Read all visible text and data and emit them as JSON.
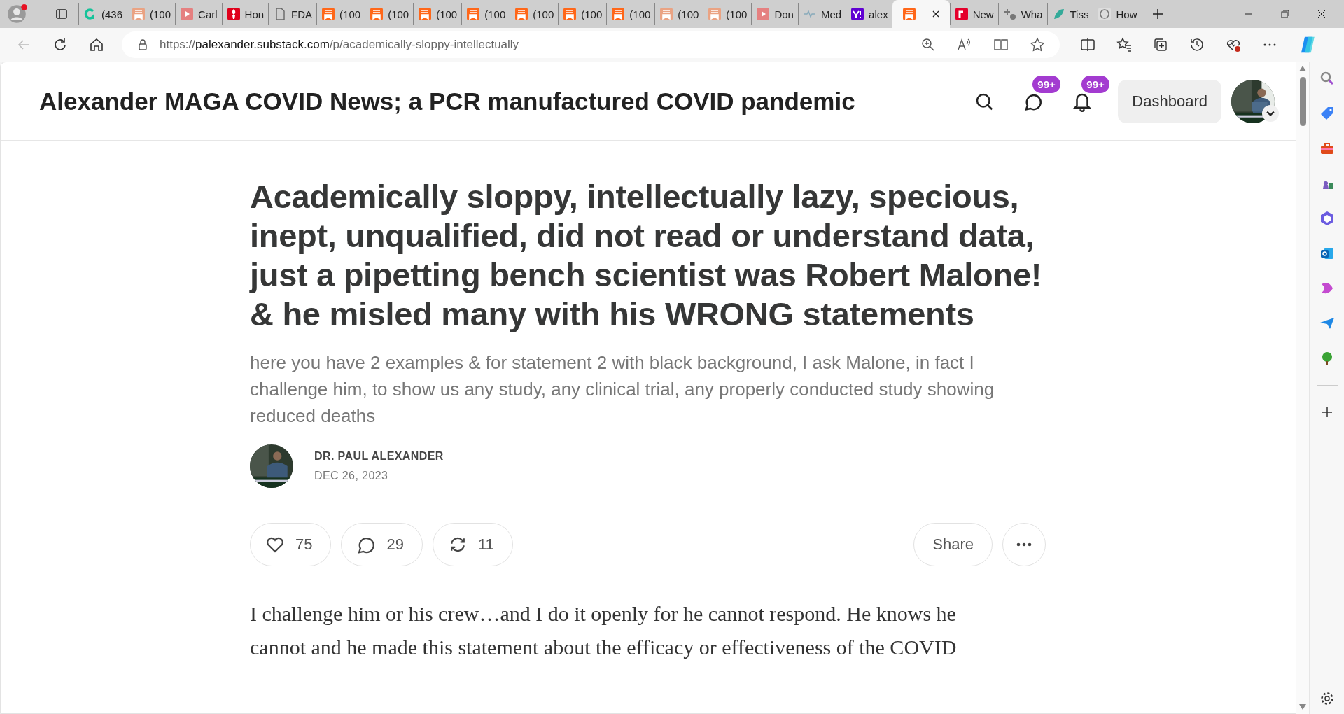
{
  "tabs": [
    {
      "kind": "grammarly",
      "label": "(436",
      "selected": false
    },
    {
      "kind": "substack-muted",
      "label": "(100",
      "selected": false
    },
    {
      "kind": "youtube",
      "label": "Carl",
      "selected": false
    },
    {
      "kind": "torch",
      "label": "Hon",
      "selected": false
    },
    {
      "kind": "document",
      "label": "FDA",
      "selected": false
    },
    {
      "kind": "substack",
      "label": "(100",
      "selected": false
    },
    {
      "kind": "substack",
      "label": "(100",
      "selected": false
    },
    {
      "kind": "substack",
      "label": "(100",
      "selected": false
    },
    {
      "kind": "substack",
      "label": "(100",
      "selected": false
    },
    {
      "kind": "substack",
      "label": "(100",
      "selected": false
    },
    {
      "kind": "substack",
      "label": "(100",
      "selected": false
    },
    {
      "kind": "substack",
      "label": "(100",
      "selected": false
    },
    {
      "kind": "substack-muted",
      "label": "(100",
      "selected": false
    },
    {
      "kind": "substack-muted",
      "label": "(100",
      "selected": false
    },
    {
      "kind": "youtube",
      "label": "Don",
      "selected": false
    },
    {
      "kind": "heartbeat",
      "label": "Med",
      "selected": false
    },
    {
      "kind": "yahoo",
      "label": "alex",
      "selected": false
    },
    {
      "kind": "substack",
      "selected": true
    },
    {
      "kind": "r-logo",
      "label": "New",
      "selected": false
    },
    {
      "kind": "sparkle",
      "label": "Wha",
      "selected": false
    },
    {
      "kind": "leaf",
      "label": "Tiss",
      "selected": false
    },
    {
      "kind": "seal",
      "label": "How",
      "selected": false
    }
  ],
  "url": {
    "scheme": "https://",
    "host": "palexander.substack.com",
    "path": "/p/academically-sloppy-intellectually"
  },
  "site": {
    "title": "Alexander MAGA COVID News; a PCR manufactured COVID pandemic",
    "chat_badge": "99+",
    "bell_badge": "99+",
    "dashboard": "Dashboard"
  },
  "article": {
    "title": "Academically sloppy, intellectually lazy, specious, inept, unqualified, did not read or understand data, just a pipetting bench scientist was Robert Malone! & he misled many with his WRONG statements",
    "subtitle": "here you have 2 examples & for statement 2 with black background, I ask Malone, in fact I challenge him, to show us any study, any clinical trial, any properly conducted study showing reduced deaths",
    "author": "DR. PAUL ALEXANDER",
    "date": "DEC 26, 2023",
    "likes": "75",
    "comments": "29",
    "restacks": "11",
    "share": "Share",
    "body_lines": [
      "I challenge him or his crew…and I do it openly for he cannot respond. He knows he",
      "cannot and he made this statement about the efficacy or effectiveness of the COVID"
    ]
  }
}
